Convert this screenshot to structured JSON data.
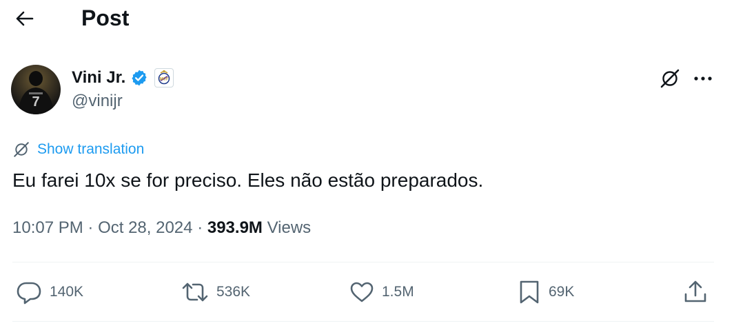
{
  "header": {
    "title": "Post",
    "back_icon": "arrow-left-icon"
  },
  "author": {
    "display_name": "Vini Jr.",
    "handle": "@vinijr",
    "verified": true,
    "verified_color": "#1d9bf0",
    "affiliate_icon": "real-madrid-crest-icon",
    "avatar_jersey_number": "7"
  },
  "post": {
    "translate_label": "Show translation",
    "text": "Eu farei 10x se for preciso. Eles não estão preparados.",
    "time": "10:07 PM",
    "date": "Oct 28, 2024",
    "separator": "·",
    "views_count": "393.9M",
    "views_label": "Views"
  },
  "actions": {
    "replies": "140K",
    "reposts": "536K",
    "likes": "1.5M",
    "bookmarks": "69K"
  },
  "colors": {
    "text_primary": "#0f1419",
    "text_secondary": "#536471",
    "accent": "#1d9bf0",
    "divider": "#eff3f4"
  }
}
